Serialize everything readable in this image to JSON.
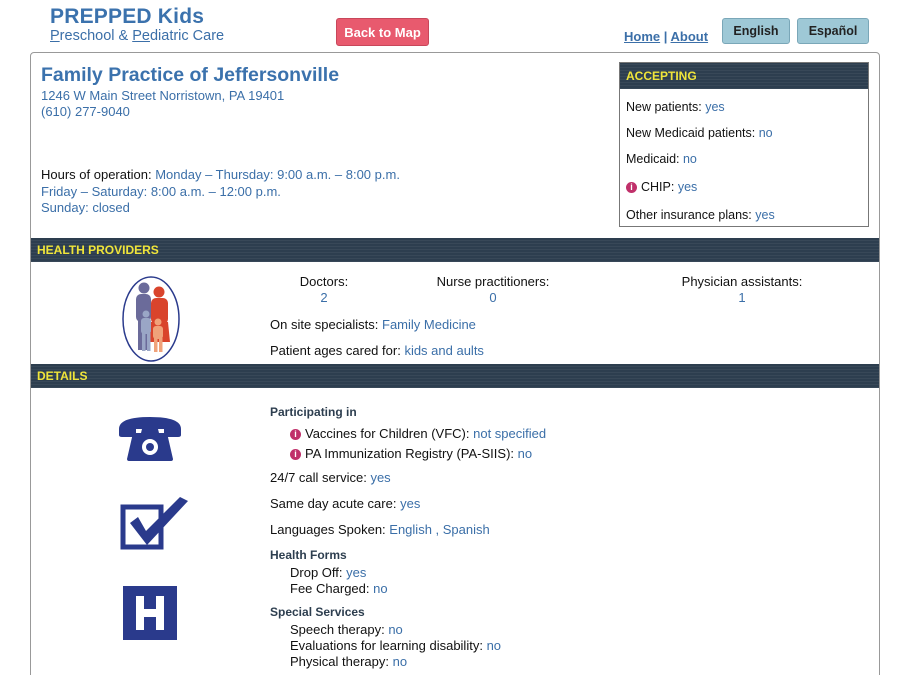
{
  "header": {
    "brand_title": "PREPPED Kids",
    "brand_sub_p1": "P",
    "brand_sub_p2": "reschool & ",
    "brand_sub_p3": "Pe",
    "brand_sub_p4": "diatric Care",
    "back_label": "Back to Map",
    "home_label": "Home",
    "separator": "|",
    "about_label": "About",
    "english_label": "English",
    "espanol_label": "Español"
  },
  "practice": {
    "name": "Family Practice of Jeffersonville",
    "address": "1246 W Main Street Norristown, PA 19401",
    "phone": "(610) 277-9040",
    "hours_label": "Hours of operation:",
    "hours_line1": "Monday – Thursday: 9:00 a.m. – 8:00 p.m.",
    "hours_line2": "Friday – Saturday: 8:00 a.m. – 12:00 p.m.",
    "hours_line3": "Sunday: closed"
  },
  "accepting": {
    "title": "ACCEPTING",
    "rows": [
      {
        "label": "New patients:",
        "value": "yes"
      },
      {
        "label": "New Medicaid patients:",
        "value": "no"
      },
      {
        "label": "Medicaid:",
        "value": "no"
      },
      {
        "label": "CHIP:",
        "value": "yes"
      },
      {
        "label": "Other insurance plans:",
        "value": "yes"
      }
    ]
  },
  "providers": {
    "title": "HEALTH PROVIDERS",
    "doctors_label": "Doctors:",
    "doctors_value": "2",
    "np_label": "Nurse practitioners:",
    "np_value": "0",
    "pa_label": "Physician assistants:",
    "pa_value": "1",
    "specialists_label": "On site specialists:",
    "specialists_value": "Family Medicine",
    "ages_label": "Patient ages cared for:",
    "ages_value": "kids and aults"
  },
  "details": {
    "title": "DETAILS",
    "participating_head": "Participating in",
    "vfc_label": "Vaccines for Children (VFC):",
    "vfc_value": "not specified",
    "pasiis_label": "PA Immunization Registry (PA-SIIS):",
    "pasiis_value": "no",
    "call_label": "24/7 call service:",
    "call_value": "yes",
    "acute_label": "Same day acute care:",
    "acute_value": "yes",
    "lang_label": "Languages Spoken:",
    "lang_value": "English , Spanish",
    "forms_head": "Health Forms",
    "dropoff_label": "Drop Off:",
    "dropoff_value": "yes",
    "fee_label": "Fee Charged:",
    "fee_value": "no",
    "special_head": "Special Services",
    "speech_label": "Speech therapy:",
    "speech_value": "no",
    "eval_label": "Evaluations for learning disability:",
    "eval_value": "no",
    "physical_label": "Physical therapy:",
    "physical_value": "no"
  },
  "info_glyph": "i",
  "icons": [
    "family-icon",
    "telephone-icon",
    "checkbox-icon",
    "hospital-icon",
    "info-icon"
  ],
  "colors": {
    "accent_blue": "#3b6fa8",
    "bar_dark": "#2d3e4f",
    "bar_text": "#f0e53a",
    "back_button": "#e85a6e",
    "lang_button": "#9ec8d6",
    "info_dot": "#c0306a",
    "icon_navy": "#2a3a8c"
  }
}
